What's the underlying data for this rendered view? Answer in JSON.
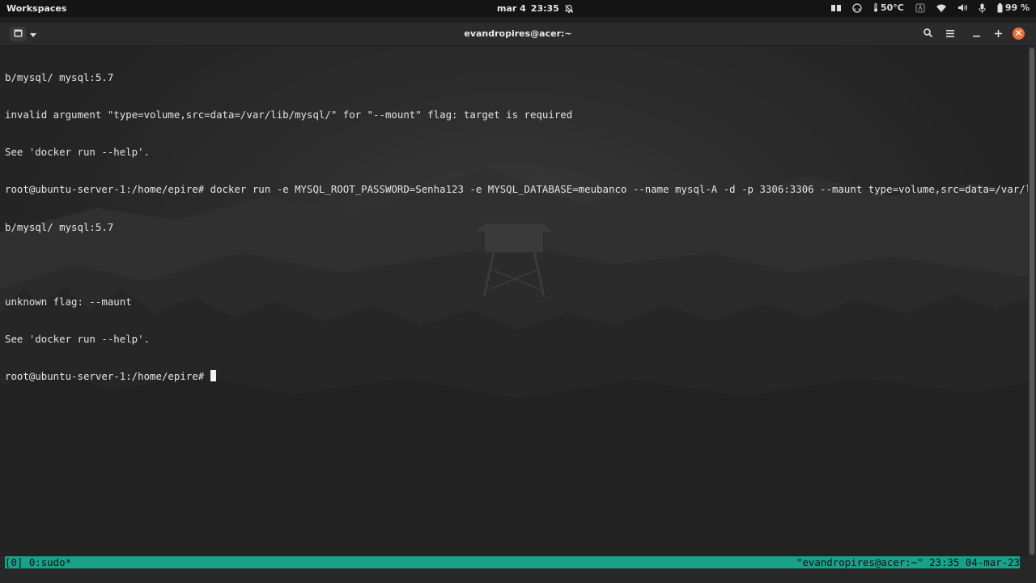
{
  "top_panel": {
    "workspaces_label": "Workspaces",
    "date": "mar 4",
    "time": "23:35",
    "temperature": "50°C",
    "battery": "99 %"
  },
  "window": {
    "title": "evandropires@acer:~"
  },
  "terminal": {
    "lines": [
      "b/mysql/ mysql:5.7",
      "invalid argument \"type=volume,src=data=/var/lib/mysql/\" for \"--mount\" flag: target is required",
      "See 'docker run --help'.",
      "root@ubuntu-server-1:/home/epire# docker run -e MYSQL_ROOT_PASSWORD=Senha123 -e MYSQL_DATABASE=meubanco --name mysql-A -d -p 3306:3306 --maunt type=volume,src=data=/var/li",
      "b/mysql/ mysql:5.7",
      "",
      "unknown flag: --maunt",
      "See 'docker run --help'."
    ],
    "prompt": "root@ubuntu-server-1:/home/epire# "
  },
  "statusbar": {
    "left": "[0] 0:sudo*",
    "right": "\"evandropires@acer:~\" 23:35 04-mar-23"
  },
  "colors": {
    "status_bar": "#1aa18a",
    "close_button": "#e8713a",
    "terminal_text": "#e4e4e4"
  },
  "icons": [
    "notifications-off-icon",
    "grid-icon",
    "headphones-icon",
    "thermometer-icon",
    "accessibility-icon",
    "wifi-icon",
    "volume-icon",
    "microphone-icon",
    "battery-icon",
    "new-tab-icon",
    "chevron-down-icon",
    "search-icon",
    "hamburger-menu-icon",
    "minimize-icon",
    "maximize-icon",
    "close-icon"
  ]
}
